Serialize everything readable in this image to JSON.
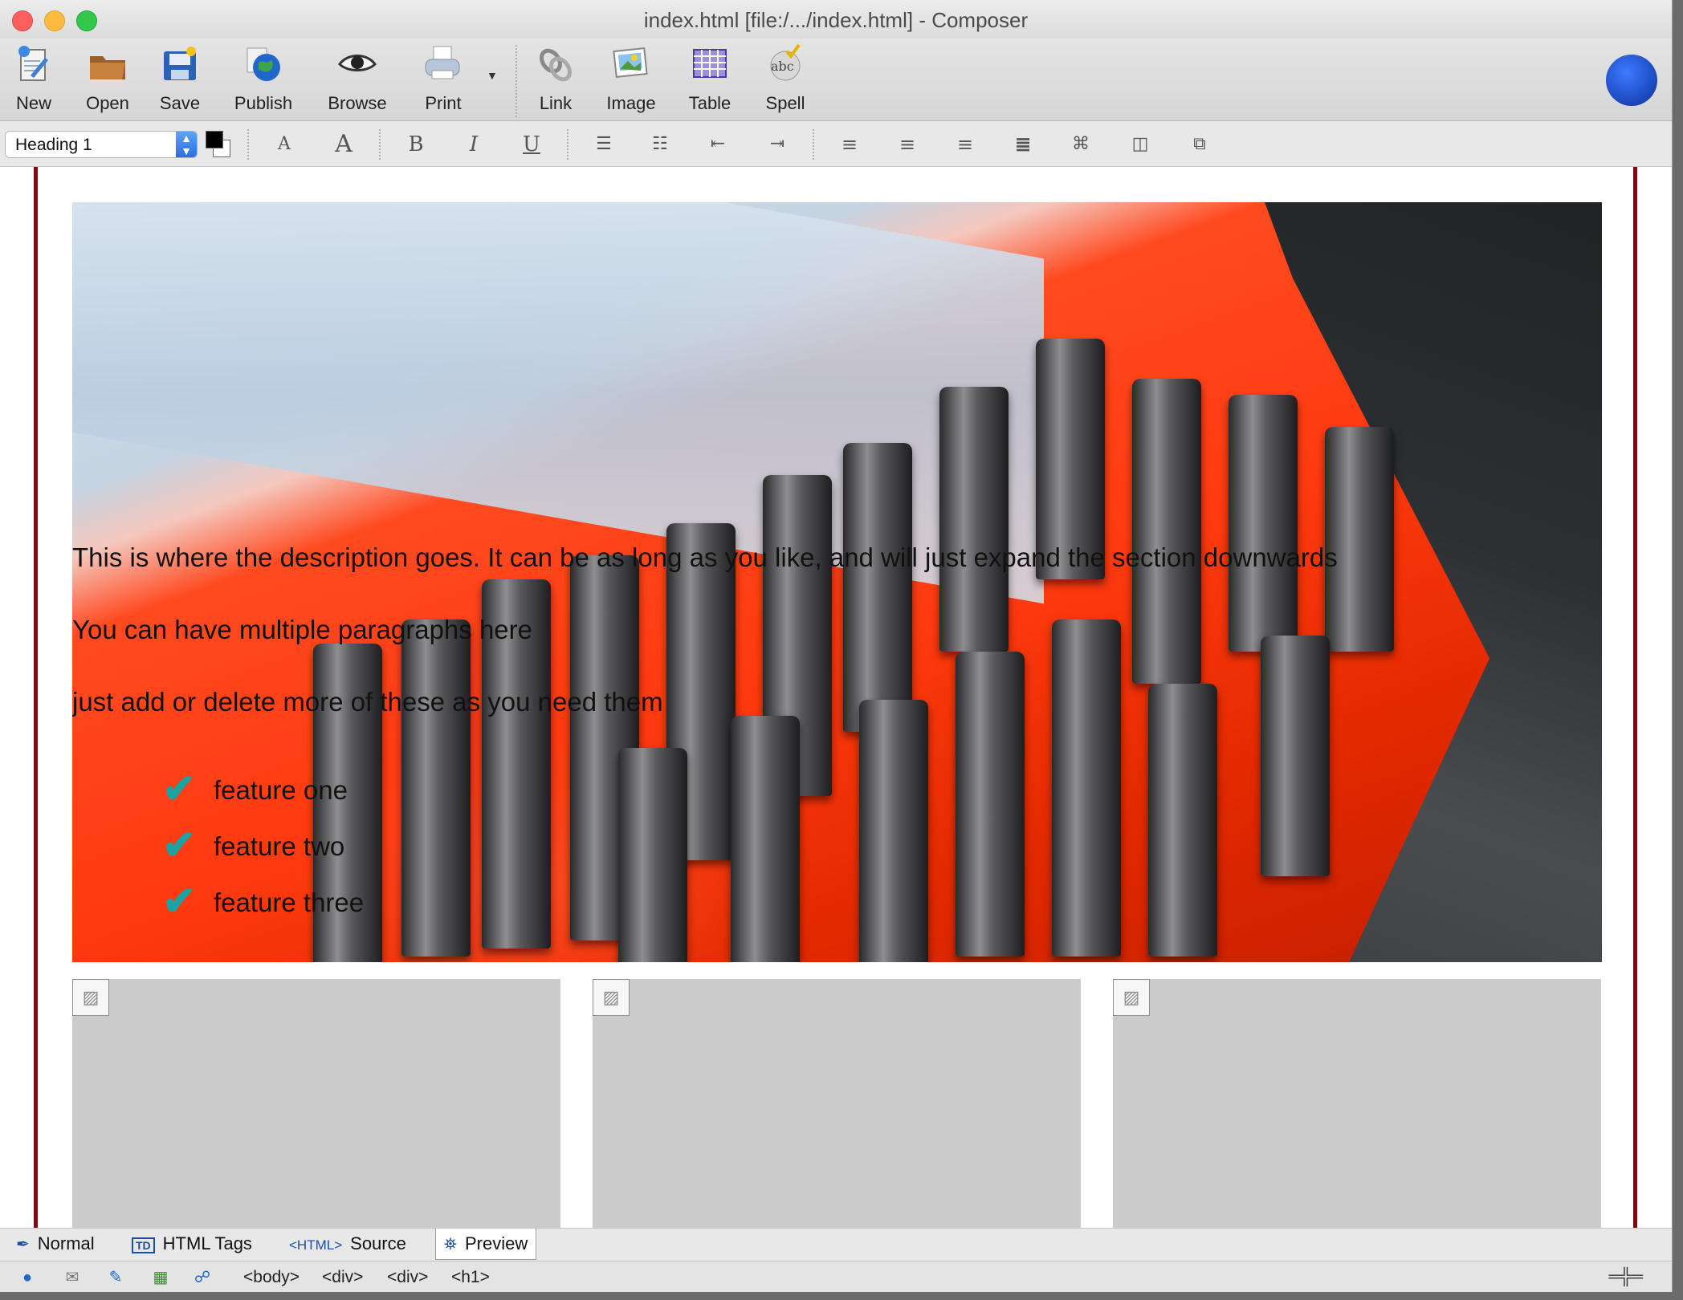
{
  "window": {
    "title": "index.html [file:/.../index.html] - Composer"
  },
  "toolbar": {
    "new_label": "New",
    "open_label": "Open",
    "save_label": "Save",
    "publish_label": "Publish",
    "browse_label": "Browse",
    "print_label": "Print",
    "link_label": "Link",
    "image_label": "Image",
    "table_label": "Table",
    "spell_label": "Spell"
  },
  "format": {
    "paragraph_style": "Heading 1",
    "text_color": "#000000",
    "bg_color": "#ffffff",
    "bold_glyph": "B",
    "italic_glyph": "I",
    "underline_glyph": "U"
  },
  "content": {
    "paragraphs": [
      "This is where the description goes. It can be as long as you like, and will just expand the section downwards",
      "You can have multiple paragraphs here",
      "just add or delete more of these as you need them"
    ],
    "features": [
      "feature one",
      "feature two",
      "feature three"
    ],
    "check_glyph": "✔",
    "check_color": "#1aa3a3",
    "border_color": "#7a0e0e"
  },
  "tabs": {
    "normal": "Normal",
    "html_tags": "HTML Tags",
    "source": "Source",
    "preview": "Preview",
    "html_tag_icon": "<HTML>",
    "td_icon": "TD"
  },
  "status": {
    "breadcrumbs": [
      "<body>",
      "<div>",
      "<div>",
      "<h1>"
    ]
  }
}
